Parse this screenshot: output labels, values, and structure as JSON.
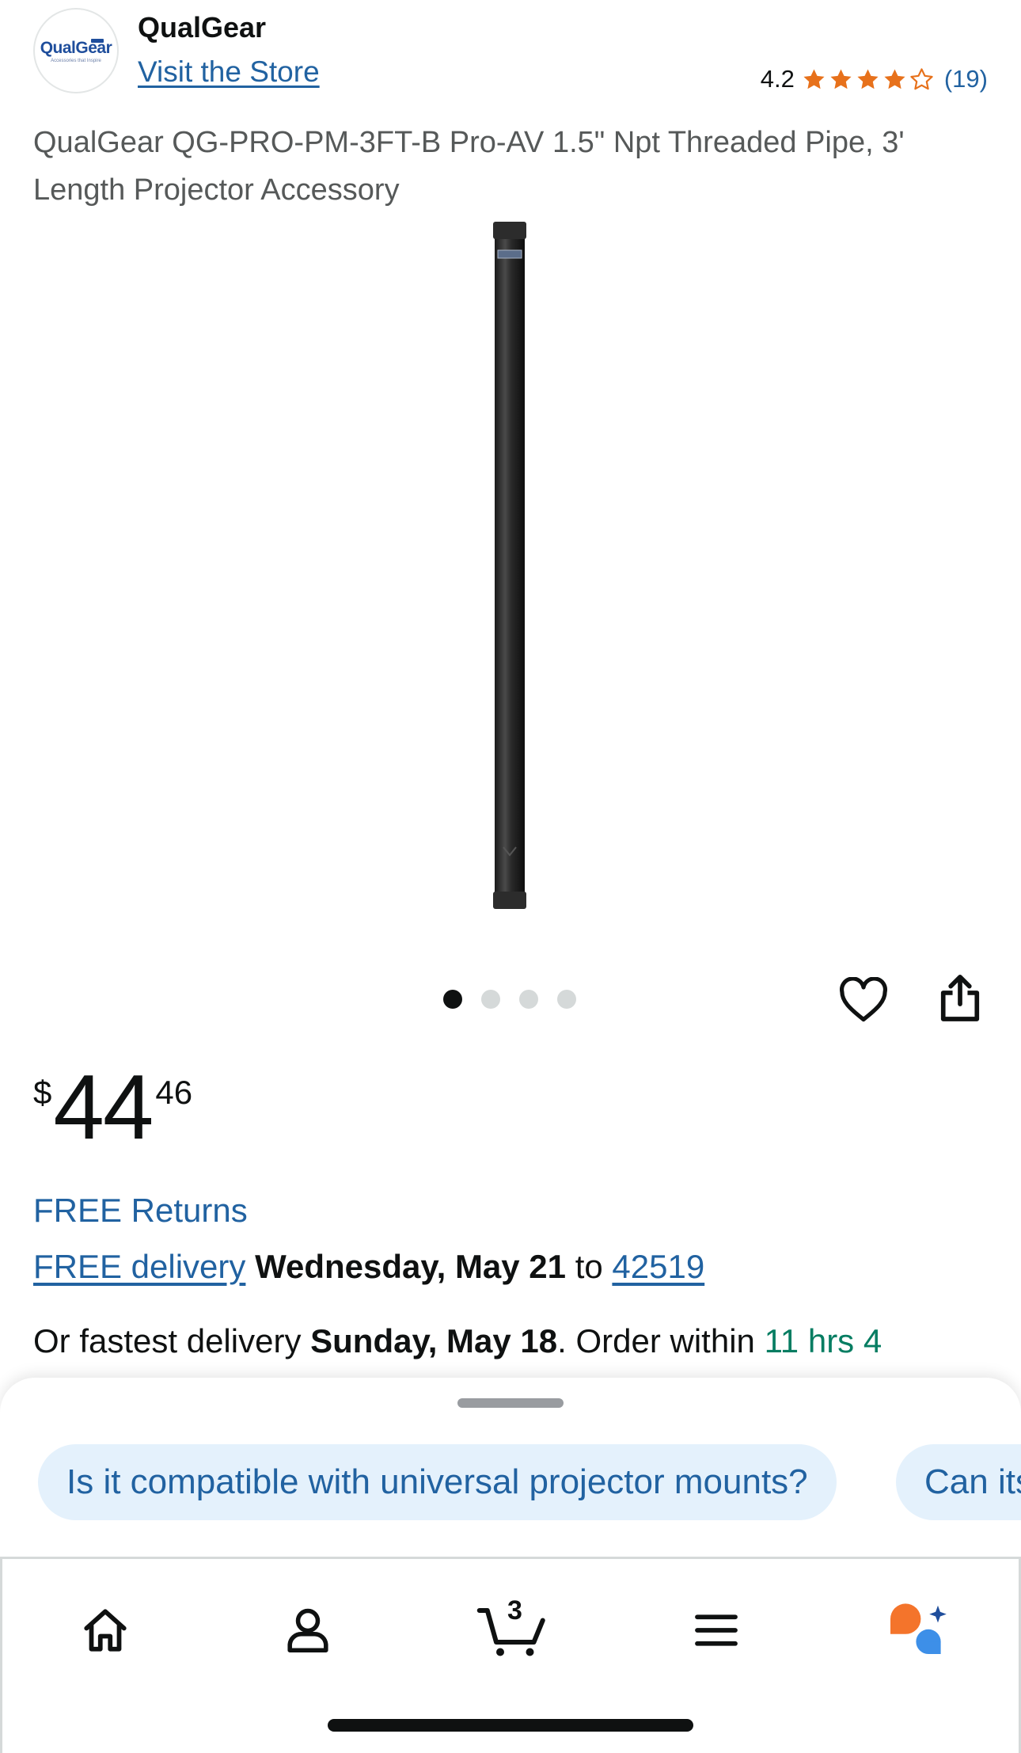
{
  "brand": {
    "logo_text": "QualGear",
    "logo_tagline": "Accessories that Inspire",
    "name": "QualGear",
    "visit_store": "Visit the Store"
  },
  "rating": {
    "value": "4.2",
    "stars_filled": 4,
    "stars_total": 5,
    "count": "(19)",
    "star_color": "#e7711b"
  },
  "product": {
    "title": "QualGear QG-PRO-PM-3FT-B Pro-AV 1.5\" Npt Threaded Pipe, 3' Length Projector Accessory",
    "image_icon": "black-threaded-pipe"
  },
  "carousel": {
    "total": 4,
    "active_index": 0
  },
  "actions": {
    "wishlist_icon": "heart-icon",
    "share_icon": "share-icon"
  },
  "price": {
    "currency": "$",
    "whole": "44",
    "fraction": "46"
  },
  "delivery": {
    "free_returns": "FREE Returns",
    "free_delivery_label": "FREE delivery",
    "delivery_date": "Wednesday, May 21",
    "to": "to",
    "zip": "42519",
    "fastest_prefix": "Or fastest delivery",
    "fastest_date": "Sunday, May 18",
    "order_within": ". Order within",
    "countdown": "11 hrs 4"
  },
  "suggestions": [
    "Is it compatible with universal projector mounts?",
    "Can its"
  ],
  "nav": {
    "cart_count": "3",
    "items": [
      "home-icon",
      "account-icon",
      "cart-icon",
      "menu-icon",
      "rufus-assistant-icon"
    ]
  },
  "colors": {
    "link": "#2162a1",
    "text": "#0f1111",
    "secondary_text": "#565959",
    "success": "#067d62",
    "chip_bg": "#e4f1fc"
  }
}
